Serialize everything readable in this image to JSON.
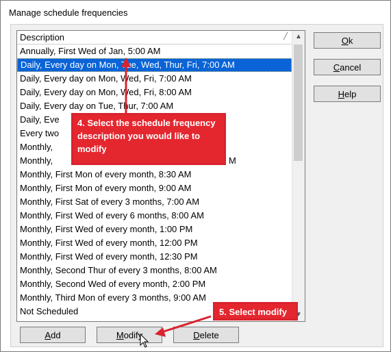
{
  "window": {
    "title": "Manage schedule frequencies"
  },
  "list": {
    "header": "Description",
    "rows": [
      "Annually, First Wed of Jan, 5:00 AM",
      "Daily, Every day on Mon, Tue, Wed, Thur, Fri, 7:00 AM",
      "Daily, Every day on Mon, Wed, Fri, 7:00 AM",
      "Daily, Every day on Mon, Wed, Fri, 8:00 AM",
      "Daily, Every day on Tue, Thur, 7:00 AM",
      "Daily, Eve",
      "Every two",
      "Monthly,",
      "Monthly,",
      "Monthly, First Mon of every month, 8:30 AM",
      "Monthly, First Mon of every month, 9:00 AM",
      "Monthly, First Sat of every 3 months, 7:00 AM",
      "Monthly, First Wed of every 6 months, 8:00 AM",
      "Monthly, First Wed of every month, 1:00 PM",
      "Monthly, First Wed of every month, 12:00 PM",
      "Monthly, First Wed of every month, 12:30 PM",
      "Monthly, Second Thur of every 3 months, 8:00 AM",
      "Monthly, Second Wed of every month, 2:00 PM",
      "Monthly, Third Mon of every 3 months, 9:00 AM",
      "Not Scheduled"
    ],
    "selected_index": 1,
    "row9_suffix": "M"
  },
  "buttons": {
    "ok": {
      "pre": "",
      "key": "O",
      "post": "k"
    },
    "cancel": {
      "pre": "",
      "key": "C",
      "post": "ancel"
    },
    "help": {
      "pre": "",
      "key": "H",
      "post": "elp"
    },
    "add": {
      "pre": "",
      "key": "A",
      "post": "dd"
    },
    "modify": {
      "pre": "",
      "key": "M",
      "post": "odify"
    },
    "delete": {
      "pre": "",
      "key": "D",
      "post": "elete"
    }
  },
  "callouts": {
    "step4": "4. Select the schedule frequency description you would like to modify",
    "step5": "5. Select modify"
  },
  "colors": {
    "selection": "#0a64d8",
    "callout": "#e4272f"
  }
}
